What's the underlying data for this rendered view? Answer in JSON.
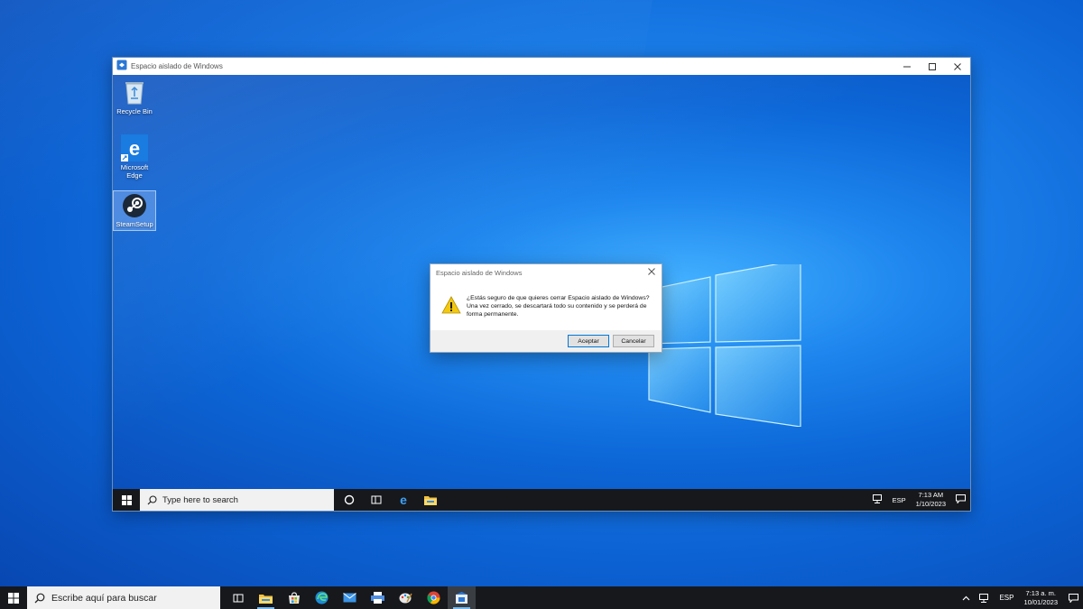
{
  "outer": {
    "search_placeholder": "Escribe aquí para buscar",
    "tray": {
      "language": "ESP",
      "time": "7:13 a. m.",
      "date": "10/01/2023"
    }
  },
  "sandbox_window": {
    "title": "Espacio aislado de Windows",
    "desktop_icons": [
      {
        "label": "Recycle Bin"
      },
      {
        "label": "Microsoft Edge"
      },
      {
        "label": "SteamSetup"
      }
    ],
    "taskbar": {
      "search_placeholder": "Type here to search",
      "language": "ESP",
      "time": "7:13 AM",
      "date": "1/10/2023"
    }
  },
  "dialog": {
    "title": "Espacio aislado de Windows",
    "message": "¿Estás seguro de que quieres cerrar Espacio aislado de Windows? Una vez cerrado, se descartará todo su contenido y se perderá de forma permanente.",
    "ok_label": "Aceptar",
    "cancel_label": "Cancelar"
  },
  "colors": {
    "accent": "#0078d7",
    "taskbar": "#16181c",
    "warning": "#f2c811"
  },
  "icons": [
    "windows-logo-icon",
    "search-icon",
    "task-view-icon",
    "file-explorer-icon",
    "store-icon",
    "edge-icon",
    "mail-icon",
    "printer-icon",
    "paint-icon",
    "chrome-icon",
    "sandbox-icon",
    "chevron-up-icon",
    "network-icon",
    "notification-icon",
    "cortana-icon",
    "recycle-bin-icon",
    "steam-icon",
    "warning-icon"
  ]
}
